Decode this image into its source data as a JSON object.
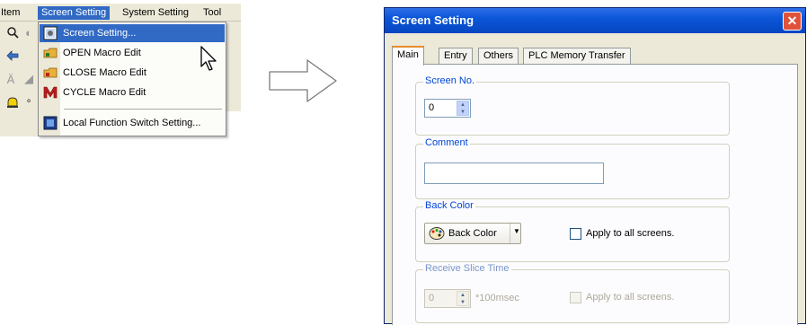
{
  "menubar": {
    "items": [
      "Item",
      "Screen Setting",
      "System Setting",
      "Tool"
    ],
    "active_index": 1
  },
  "dropdown": {
    "items": [
      {
        "label": "Screen Setting...",
        "icon": "screen-setting-icon"
      },
      {
        "label": "OPEN Macro Edit",
        "icon": "open-macro-icon"
      },
      {
        "label": "CLOSE Macro Edit",
        "icon": "close-macro-icon"
      },
      {
        "label": "CYCLE Macro Edit",
        "icon": "cycle-macro-icon"
      },
      {
        "label": "Local Function Switch Setting...",
        "icon": "local-function-switch-icon"
      }
    ],
    "highlighted_index": 0
  },
  "dialog": {
    "title": "Screen Setting",
    "close_glyph": "✕",
    "tabs": [
      "Main",
      "Entry",
      "Others",
      "PLC Memory Transfer"
    ],
    "active_tab": 0,
    "screen_no": {
      "label": "Screen No.",
      "value": "0"
    },
    "comment": {
      "label": "Comment",
      "value": ""
    },
    "back_color": {
      "label": "Back Color",
      "button_label": "Back Color",
      "apply_label": "Apply to all screens."
    },
    "receive_slice": {
      "label": "Receive Slice Time",
      "value": "0",
      "unit": "*100msec",
      "apply_label": "Apply to all screens."
    }
  },
  "colors": {
    "menu_highlight": "#316ac5",
    "titlebar": "#0a56d8",
    "group_label": "#0046d5",
    "dialog_bg": "#ece9d8"
  }
}
